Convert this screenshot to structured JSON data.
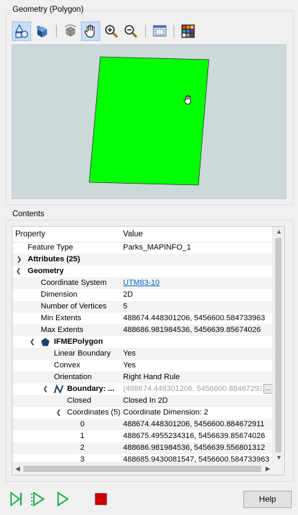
{
  "geometry_panel": {
    "title": "Geometry (Polygon)",
    "toolbar": [
      {
        "name": "select-icon",
        "active": true
      },
      {
        "name": "3d-view-icon",
        "active": false
      },
      {
        "name": "rotate-icon",
        "active": false
      },
      {
        "name": "pan-hand-icon",
        "active": true
      },
      {
        "name": "zoom-in-icon",
        "active": false
      },
      {
        "name": "zoom-out-icon",
        "active": false
      },
      {
        "name": "zoom-extents-icon",
        "active": false
      },
      {
        "name": "color-grid-icon",
        "active": false
      }
    ],
    "polygon_color": "#00ff00",
    "background_color": "#ccd9db"
  },
  "contents_panel": {
    "title": "Contents",
    "columns": {
      "property": "Property",
      "value": "Value"
    },
    "rows": [
      {
        "property": "Feature Type",
        "value": "Parks_MAPINFO_1"
      },
      {
        "property": "Attributes (25)",
        "value": ""
      },
      {
        "property": "Geometry",
        "value": ""
      },
      {
        "property": "Coordinate System",
        "value": "UTM83-10"
      },
      {
        "property": "Dimension",
        "value": "2D"
      },
      {
        "property": "Number of Vertices",
        "value": "5"
      },
      {
        "property": "Min Extents",
        "value": "488674.448301206, 5456600.584733963"
      },
      {
        "property": "Max Extents",
        "value": "488686.981984536, 5456639.85674026"
      },
      {
        "property": "IFMEPolygon",
        "value": ""
      },
      {
        "property": "Linear Boundary",
        "value": "Yes"
      },
      {
        "property": "Convex",
        "value": "Yes"
      },
      {
        "property": "Orientation",
        "value": "Right Hand Rule"
      },
      {
        "property": "Boundary: ...",
        "value": "(488674.448301206, 5456600.88467291..."
      },
      {
        "property": "Closed",
        "value": "Closed In 2D"
      },
      {
        "property": "Coordinates (5)",
        "value": "Coordinate Dimension: 2"
      },
      {
        "property": "0",
        "value": "488674.448301206, 5456600.884672911"
      },
      {
        "property": "1",
        "value": "488675.4955234316, 5456639.85674026"
      },
      {
        "property": "2",
        "value": "488686.981984536, 5456639.556801312"
      },
      {
        "property": "3",
        "value": "488685.9430081547, 5456600.584733963"
      }
    ]
  },
  "footer": {
    "help_label": "Help",
    "run_color": "#22b14c",
    "stop_color": "#cc0000"
  }
}
